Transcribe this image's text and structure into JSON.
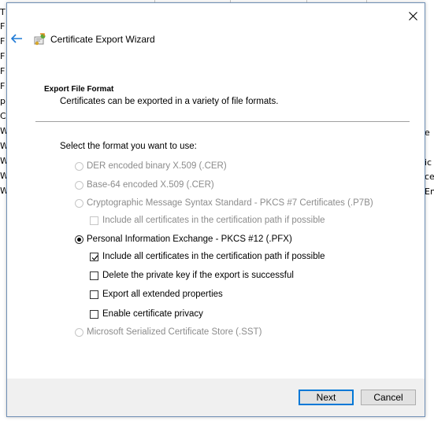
{
  "background": {
    "left_letters": [
      "T",
      "F",
      "F",
      "F",
      "F",
      "F",
      "p",
      "C",
      "W",
      "W",
      "W",
      "W",
      "W"
    ],
    "right_fragments": [
      "e",
      "ic",
      "ce",
      "En"
    ]
  },
  "dialog": {
    "title": "Certificate Export Wizard",
    "section_title": "Export File Format",
    "section_desc": "Certificates can be exported in a variety of file formats.",
    "prompt": "Select the format you want to use:",
    "options": {
      "der": "DER encoded binary X.509 (.CER)",
      "base64": "Base-64 encoded X.509 (.CER)",
      "pkcs7": "Cryptographic Message Syntax Standard - PKCS #7 Certificates (.P7B)",
      "pkcs7_include": "Include all certificates in the certification path if possible",
      "pfx": "Personal Information Exchange - PKCS #12 (.PFX)",
      "pfx_include": "Include all certificates in the certification path if possible",
      "pfx_delete_key": "Delete the private key if the export is successful",
      "pfx_export_props": "Export all extended properties",
      "pfx_privacy": "Enable certificate privacy",
      "sst": "Microsoft Serialized Certificate Store (.SST)"
    },
    "buttons": {
      "next": "Next",
      "cancel": "Cancel"
    }
  },
  "colors": {
    "accent": "#0078d7",
    "disabled_text": "#8c8c8c",
    "footer_bg": "#f0f0f0"
  },
  "icons": [
    "back-arrow-icon",
    "certificate-wizard-icon",
    "close-icon"
  ]
}
